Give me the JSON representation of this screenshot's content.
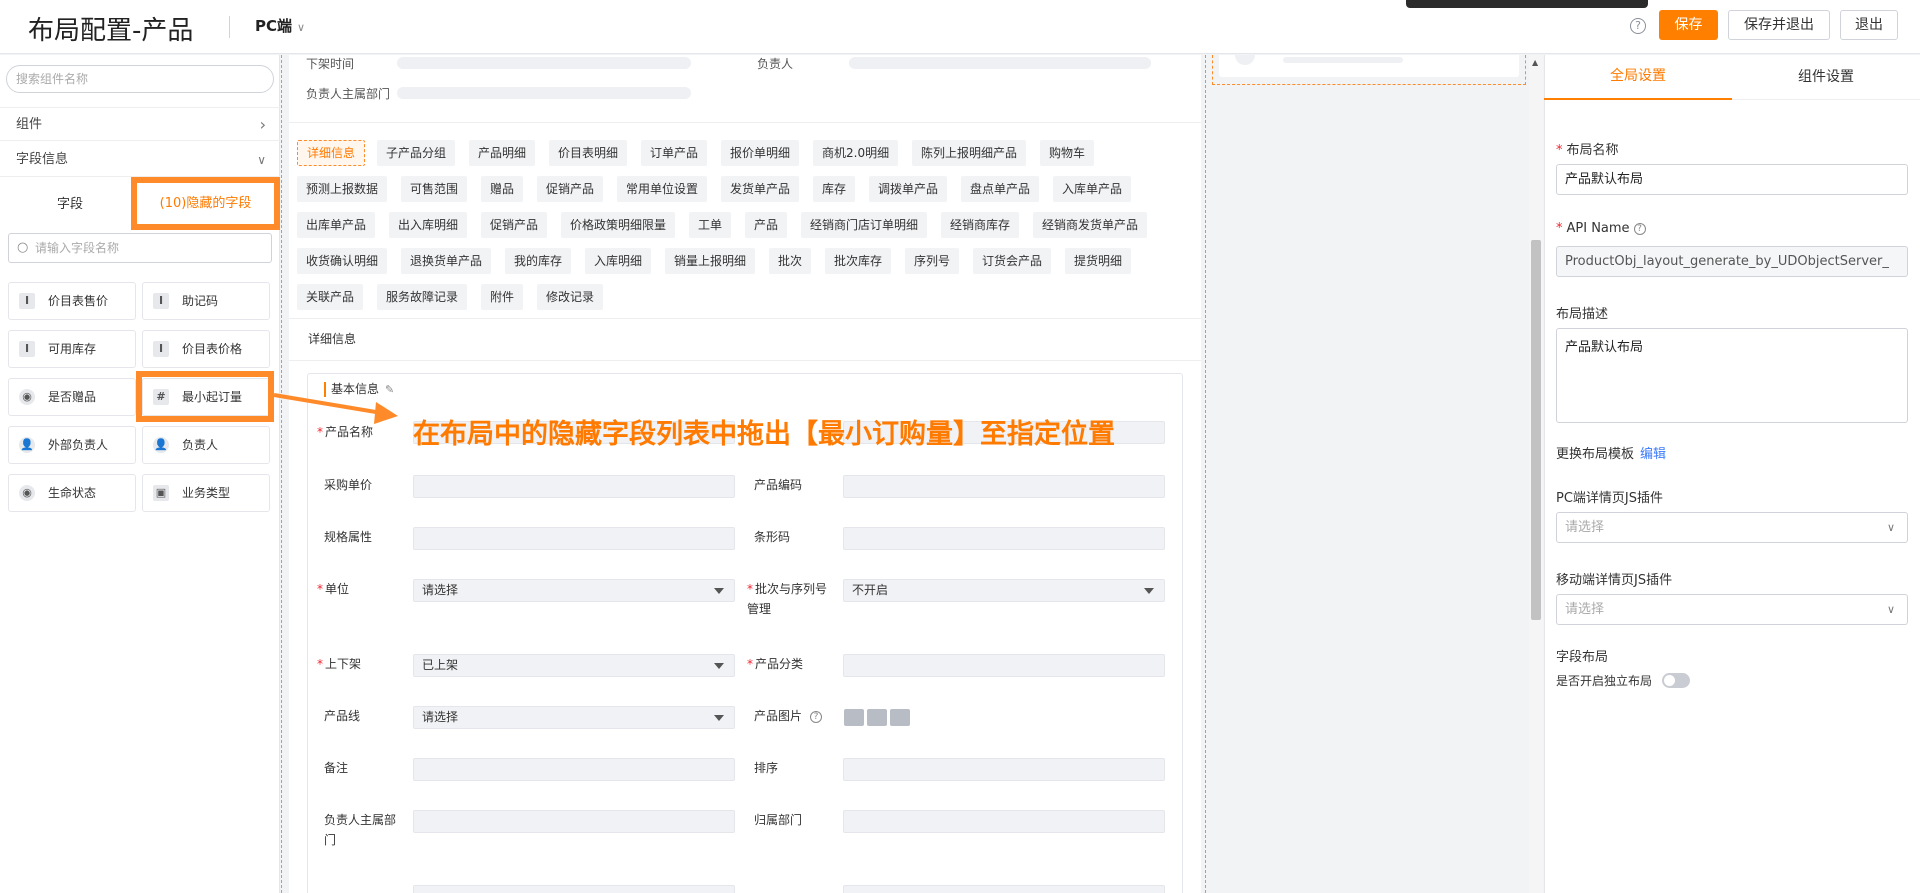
{
  "header": {
    "title": "布局配置-产品",
    "platform": "PC端",
    "help": "?",
    "save": "保存",
    "save_exit": "保存并退出",
    "exit": "退出"
  },
  "left": {
    "search_component_placeholder": "搜索组件名称",
    "components_label": "组件",
    "field_info_label": "字段信息",
    "tab_fields": "字段",
    "tab_hidden": "(10)隐藏的字段",
    "search_field_placeholder": "请输入字段名称",
    "fields": [
      {
        "name": "价目表售价",
        "icon": "I"
      },
      {
        "name": "助记码",
        "icon": "I"
      },
      {
        "name": "可用库存",
        "icon": "I"
      },
      {
        "name": "价目表价格",
        "icon": "I"
      },
      {
        "name": "是否赠品",
        "icon": "◉"
      },
      {
        "name": "最小起订量",
        "icon": "#"
      },
      {
        "name": "外部负责人",
        "icon": "👤"
      },
      {
        "name": "负责人",
        "icon": "👤"
      },
      {
        "name": "生命状态",
        "icon": "◉"
      },
      {
        "name": "业务类型",
        "icon": "▣"
      }
    ]
  },
  "middle": {
    "top_rows": [
      "下架时间",
      "负责人",
      "负责人主属部门"
    ],
    "chips": [
      [
        "详细信息",
        "子产品分组",
        "产品明细",
        "价目表明细",
        "订单产品",
        "报价单明细",
        "商机2.0明细",
        "陈列上报明细产品",
        "购物车"
      ],
      [
        "预测上报数据",
        "可售范围",
        "赠品",
        "促销产品",
        "常用单位设置",
        "发货单产品",
        "库存",
        "调拨单产品",
        "盘点单产品",
        "入库单产品"
      ],
      [
        "出库单产品",
        "出入库明细",
        "促销产品",
        "价格政策明细限量",
        "工单",
        "产品",
        "经销商门店订单明细",
        "经销商库存",
        "经销商发货单产品"
      ],
      [
        "收货确认明细",
        "退换货单产品",
        "我的库存",
        "入库明细",
        "销量上报明细",
        "批次",
        "批次库存",
        "序列号",
        "订货会产品",
        "提货明细"
      ],
      [
        "关联产品",
        "服务故障记录",
        "附件",
        "修改记录"
      ]
    ],
    "detail_label": "详细信息",
    "section_title": "基本信息",
    "form": {
      "product_name": "产品名称",
      "purchase_price": "采购单价",
      "product_code": "产品编码",
      "spec": "规格属性",
      "barcode": "条形码",
      "unit": "单位",
      "unit_value": "请选择",
      "batch": "批次与序列号管理",
      "batch_value": "不开启",
      "shelf": "上下架",
      "shelf_value": "已上架",
      "category": "产品分类",
      "line": "产品线",
      "line_value": "请选择",
      "image": "产品图片",
      "remark": "备注",
      "sort": "排序",
      "owner_dept": "负责人主属部门",
      "dept": "归属部门"
    },
    "annotation": "在布局中的隐藏字段列表中拖出【最小订购量】至指定位置"
  },
  "right": {
    "tab_global": "全局设置",
    "tab_component": "组件设置",
    "layout_name_label": "布局名称",
    "layout_name_value": "产品默认布局",
    "api_name_label": "API Name",
    "api_name_value": "ProductObj_layout_generate_by_UDObjectServer_",
    "desc_label": "布局描述",
    "desc_value": "产品默认布局",
    "template_label": "更换布局模板",
    "template_edit": "编辑",
    "pc_plugin_label": "PC端详情页JS插件",
    "pc_plugin_placeholder": "请选择",
    "mobile_plugin_label": "移动端详情页JS插件",
    "mobile_plugin_placeholder": "请选择",
    "field_layout_label": "字段布局",
    "independent_label": "是否开启独立布局"
  },
  "colors": {
    "accent": "#ff8000",
    "highlight": "#ff8a2a",
    "link": "#3a7afe",
    "required": "#f5222d"
  }
}
